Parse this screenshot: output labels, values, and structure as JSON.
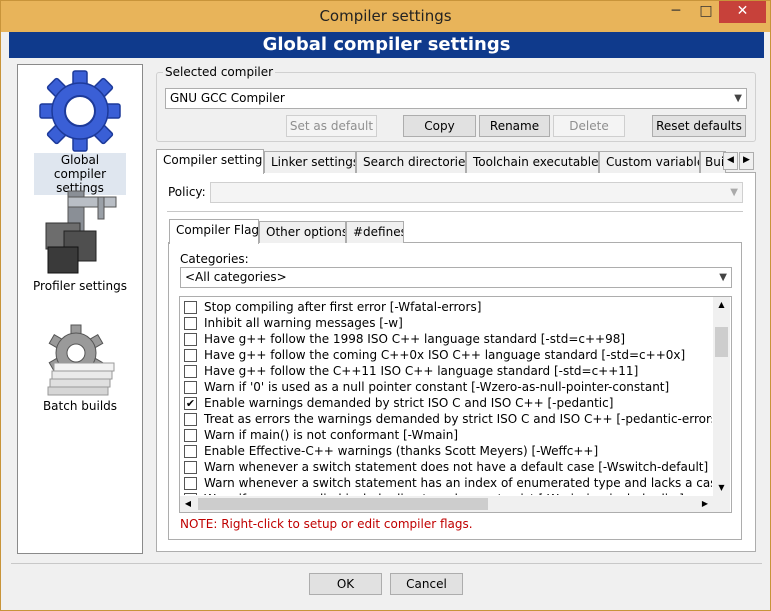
{
  "window": {
    "title": "Compiler settings",
    "minimize": "─",
    "maximize": "□",
    "close": "✕"
  },
  "header": {
    "title": "Global compiler settings"
  },
  "sidebar": {
    "items": [
      {
        "label": "Global compiler settings",
        "icon": "gear-icon",
        "selected": true
      },
      {
        "label": "Profiler settings",
        "icon": "caliper-icon",
        "selected": false
      },
      {
        "label": "Batch builds",
        "icon": "batch-gear-icon",
        "selected": false
      }
    ]
  },
  "selected_compiler": {
    "group_label": "Selected compiler",
    "value": "GNU GCC Compiler",
    "buttons": {
      "set_default": "Set as default",
      "copy": "Copy",
      "rename": "Rename",
      "delete": "Delete",
      "reset": "Reset defaults"
    }
  },
  "main_tabs": [
    "Compiler settings",
    "Linker settings",
    "Search directories",
    "Toolchain executables",
    "Custom variables",
    "Bui"
  ],
  "policy": {
    "label": "Policy:",
    "value": ""
  },
  "sub_tabs": [
    "Compiler Flags",
    "Other options",
    "#defines"
  ],
  "categories": {
    "label": "Categories:",
    "value": "<All categories>"
  },
  "flags": [
    {
      "text": "Stop compiling after first error  [-Wfatal-errors]",
      "checked": false
    },
    {
      "text": "Inhibit all warning messages  [-w]",
      "checked": false
    },
    {
      "text": "Have g++ follow the 1998 ISO C++ language standard  [-std=c++98]",
      "checked": false
    },
    {
      "text": "Have g++ follow the coming C++0x ISO C++ language standard  [-std=c++0x]",
      "checked": false
    },
    {
      "text": "Have g++ follow the C++11 ISO C++ language standard  [-std=c++11]",
      "checked": false
    },
    {
      "text": "Warn if '0' is used as a null pointer constant  [-Wzero-as-null-pointer-constant]",
      "checked": false
    },
    {
      "text": "Enable warnings demanded by strict ISO C and ISO C++  [-pedantic]",
      "checked": true
    },
    {
      "text": "Treat as errors the warnings demanded by strict ISO C and ISO C++  [-pedantic-errors]",
      "checked": false
    },
    {
      "text": "Warn if main() is not conformant  [-Wmain]",
      "checked": false
    },
    {
      "text": "Enable Effective-C++ warnings (thanks Scott Meyers)  [-Weffc++]",
      "checked": false
    },
    {
      "text": "Warn whenever a switch statement does not have a default case  [-Wswitch-default]",
      "checked": false
    },
    {
      "text": "Warn whenever a switch statement has an index of enumerated type and lacks a case for one or more of the named codes of that enumeration",
      "checked": false
    },
    {
      "text": "Warn if a user-supplied include directory does not exist  [-Wmissing-include-dirs]",
      "checked": false
    }
  ],
  "note": "NOTE: Right-click to setup or edit compiler flags.",
  "dialog_buttons": {
    "ok": "OK",
    "cancel": "Cancel"
  }
}
